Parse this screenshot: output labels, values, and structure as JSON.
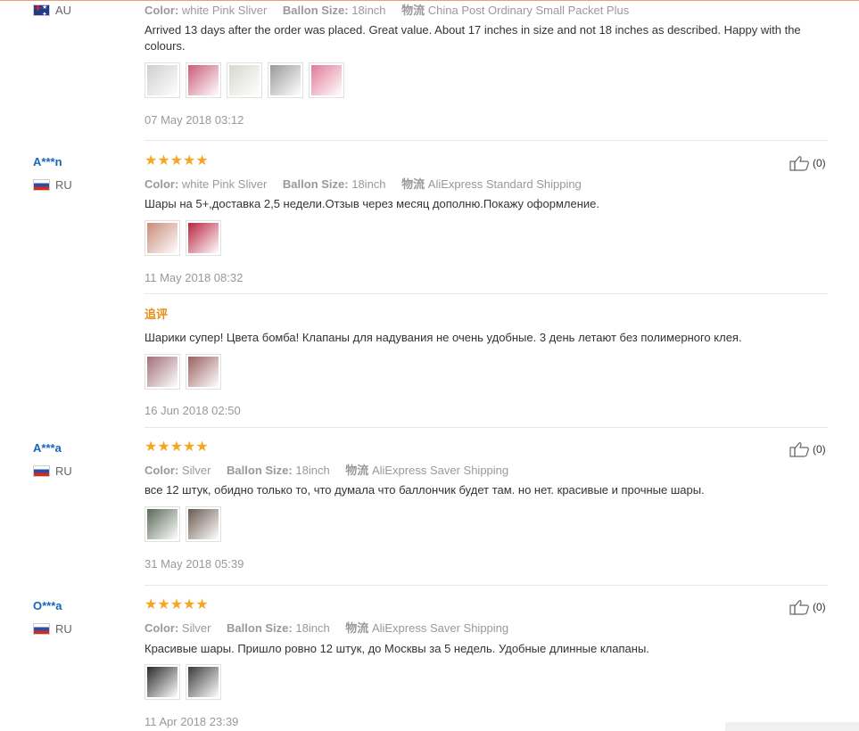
{
  "reviews": [
    {
      "country": "AU",
      "attrs": {
        "color_key": "Color:",
        "color_val": "white Pink Sliver",
        "size_key": "Ballon Size:",
        "size_val": "18inch",
        "ship_key": "物流",
        "ship_val": "China Post Ordinary Small Packet Plus"
      },
      "text": "Arrived 13 days after the order was placed. Great value. About 17 inches in size and not 18 inches as described. Happy with the colours.",
      "date": "07 May 2018 03:12",
      "thumbs": [
        "#cfcfcf",
        "#c95b7a",
        "#d8d8d0",
        "#9a9a9a",
        "#e07a98"
      ]
    },
    {
      "user": "A***n",
      "country": "RU",
      "stars": "★★★★★",
      "helpful_count": "(0)",
      "attrs": {
        "color_key": "Color:",
        "color_val": "white Pink Sliver",
        "size_key": "Ballon Size:",
        "size_val": "18inch",
        "ship_key": "物流",
        "ship_val": "AliExpress Standard Shipping"
      },
      "text": "Шары на 5+,доставка 2,5 недели.Отзыв через месяц дополню.Покажу оформление.",
      "date": "11 May 2018 08:32",
      "thumbs": [
        "#c98a7a",
        "#b8233f"
      ],
      "followup": {
        "label": "追评",
        "text": "Шарики супер! Цвета бомба! Клапаны для надувания не очень удобные. 3 день летают без полимерного клея.",
        "date": "16 Jun 2018 02:50",
        "thumbs": [
          "#a0707a",
          "#9a6060"
        ]
      }
    },
    {
      "user": "A***a",
      "country": "RU",
      "stars": "★★★★★",
      "helpful_count": "(0)",
      "attrs": {
        "color_key": "Color:",
        "color_val": "Silver",
        "size_key": "Ballon Size:",
        "size_val": "18inch",
        "ship_key": "物流",
        "ship_val": "AliExpress Saver Shipping"
      },
      "text": "все 12 штук, обидно только то, что думала что баллончик будет там. но нет. красивые и прочные шары.",
      "date": "31 May 2018 05:39",
      "thumbs": [
        "#5a6a5a",
        "#6a5a50"
      ]
    },
    {
      "user": "O***a",
      "country": "RU",
      "stars": "★★★★★",
      "helpful_count": "(0)",
      "attrs": {
        "color_key": "Color:",
        "color_val": "Silver",
        "size_key": "Ballon Size:",
        "size_val": "18inch",
        "ship_key": "物流",
        "ship_val": "AliExpress Saver Shipping"
      },
      "text": "Красивые шары. Пришло ровно 12 штук, до Москвы за 5 недель. Удобные длинные клапаны.",
      "date": "11 Apr 2018 23:39",
      "thumbs": [
        "#2a2a2a",
        "#3a3a3a"
      ]
    }
  ]
}
